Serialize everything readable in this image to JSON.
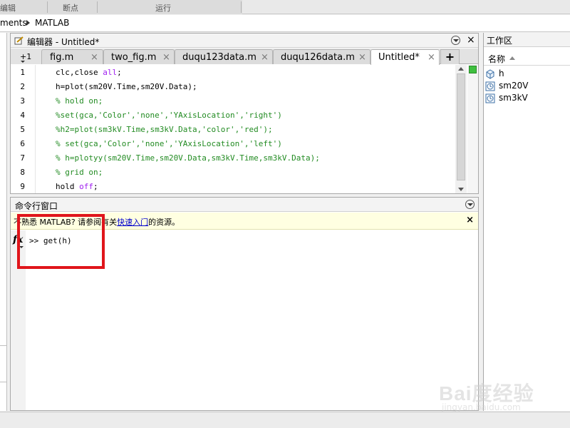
{
  "ribbon": {
    "sections": [
      "编辑",
      "断点",
      "运行"
    ]
  },
  "address": {
    "prefix": "ments",
    "folder": "MATLAB"
  },
  "editor": {
    "title": "编辑器 - Untitled*",
    "prev_tab_label": "+1",
    "tabs": [
      {
        "label": "fig.m",
        "close": "×"
      },
      {
        "label": "two_fig.m",
        "close": "×"
      },
      {
        "label": "duqu123data.m",
        "close": "×"
      },
      {
        "label": "duqu126data.m",
        "close": "×"
      },
      {
        "label": "Untitled*",
        "close": "×"
      }
    ],
    "add_tab": "+",
    "line_numbers": [
      "1",
      "2",
      "3",
      "4",
      "5",
      "6",
      "7",
      "8",
      "9"
    ],
    "lines": {
      "l1a": "clc,close ",
      "l1b": "all",
      "l1c": ";",
      "l2": "h=plot(sm20V.Time,sm20V.Data);",
      "l3": "% hold on;",
      "l4": "%set(gca,'Color','none','YAxisLocation','right')",
      "l5": "%h2=plot(sm3kV.Time,sm3kV.Data,'color','red');",
      "l6": "% set(gca,'Color','none','YAxisLocation','left')",
      "l7": "% h=plotyy(sm20V.Time,sm20V.Data,sm3kV.Time,sm3kV.Data);",
      "l8": "% grid on;",
      "l9a": "hold ",
      "l9b": "off",
      "l9c": ";"
    }
  },
  "command_window": {
    "title": "命令行窗口",
    "notice_prefix": "不熟悉 MATLAB? 请参阅有关",
    "notice_link": "快速入门",
    "notice_suffix": "的资源。",
    "notice_close": "×",
    "fx": "fx",
    "prompt_line": ">> get(h)"
  },
  "workspace": {
    "title": "工作区",
    "column_name": "名称",
    "variables": [
      "h",
      "sm20V",
      "sm3kV"
    ]
  },
  "watermark": {
    "brand": "Bai度经验",
    "url": "jingyan.baidu.com"
  },
  "colors": {
    "highlight_box": "#e0151b",
    "comment": "#228b22",
    "keyword": "#0000ff",
    "string_keyword": "#a020f0",
    "notice_bg": "#ffffe1"
  }
}
